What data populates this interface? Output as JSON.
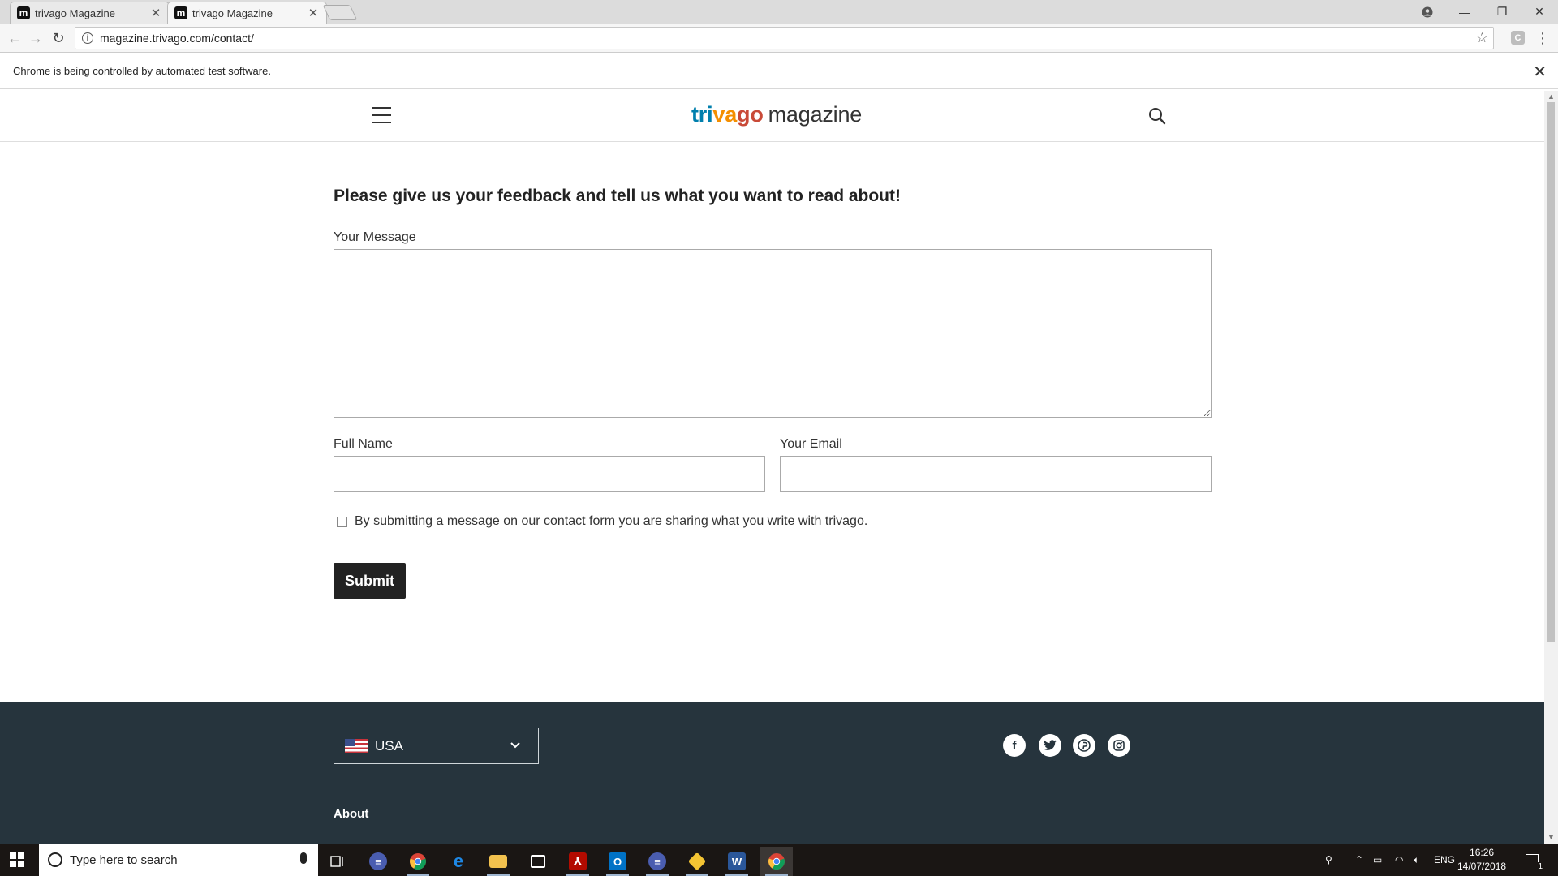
{
  "browser": {
    "tabs": [
      {
        "title": "trivago Magazine",
        "favicon": "m",
        "active": false
      },
      {
        "title": "trivago Magazine",
        "favicon": "m",
        "active": true
      }
    ],
    "url": "magazine.trivago.com/contact/",
    "extension_letter": "C",
    "infobar_text": "Chrome is being controlled by automated test software."
  },
  "site": {
    "logo": {
      "part1": "tri",
      "part2": "va",
      "part3": "go",
      "part4": "magazine"
    },
    "brand_colors": {
      "blue": "#007fad",
      "orange": "#f48f00",
      "red": "#c94a38",
      "footer_bg": "#26343d"
    }
  },
  "form": {
    "headline": "Please give us your feedback and tell us what you want to read about!",
    "message_label": "Your Message",
    "message_value": "",
    "name_label": "Full Name",
    "name_value": "",
    "email_label": "Your Email",
    "email_value": "",
    "consent_text": "By submitting a message on our contact form you are sharing what you write with trivago.",
    "consent_checked": false,
    "submit_label": "Submit"
  },
  "footer": {
    "country": "USA",
    "social_icons": [
      "facebook-icon",
      "twitter-icon",
      "pinterest-icon",
      "instagram-icon"
    ],
    "about_label": "About"
  },
  "taskbar": {
    "search_placeholder": "Type here to search",
    "apps": [
      "task-view-icon",
      "vpn-app-icon",
      "chrome-icon",
      "edge-icon",
      "file-explorer-icon",
      "store-icon",
      "acrobat-icon",
      "outlook-icon",
      "vpn-app-2-icon",
      "git-icon",
      "word-icon",
      "chrome-active-icon"
    ],
    "language": "ENG",
    "time": "16:26",
    "date": "14/07/2018",
    "notification_count": "1"
  }
}
